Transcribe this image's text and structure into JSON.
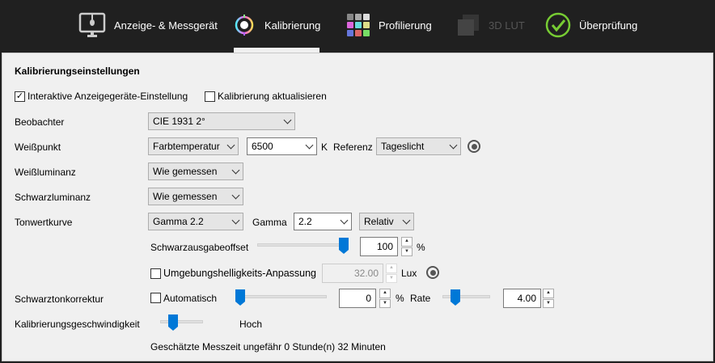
{
  "tabs": [
    {
      "label": "Anzeige- & Messgerät"
    },
    {
      "label": "Kalibrierung"
    },
    {
      "label": "Profilierung"
    },
    {
      "label": "3D LUT"
    },
    {
      "label": "Überprüfung"
    }
  ],
  "section_title": "Kalibrierungseinstellungen",
  "interactive": {
    "label": "Interaktive Anzeigegeräte-Einstellung",
    "checked": true
  },
  "update": {
    "label": "Kalibrierung aktualisieren",
    "checked": false
  },
  "observer": {
    "label": "Beobachter",
    "value": "CIE 1931 2°"
  },
  "whitepoint": {
    "label": "Weißpunkt",
    "mode": "Farbtemperatur",
    "temp": "6500",
    "unit": "K",
    "ref_label": "Referenz",
    "ref": "Tageslicht"
  },
  "white_lum": {
    "label": "Weißluminanz",
    "value": "Wie gemessen"
  },
  "black_lum": {
    "label": "Schwarzluminanz",
    "value": "Wie gemessen"
  },
  "tone": {
    "label": "Tonwertkurve",
    "curve": "Gamma 2.2",
    "gamma_label": "Gamma",
    "gamma": "2.2",
    "mode": "Relativ"
  },
  "black_offset": {
    "label": "Schwarzausgabeoffset",
    "value": "100",
    "unit": "%",
    "slider_percent": 100
  },
  "ambient": {
    "label": "Umgebungshelligkeits-Anpassung",
    "checked": false,
    "value": "32.00",
    "unit": "Lux"
  },
  "black_corr": {
    "label": "Schwarztonkorrektur",
    "auto_label": "Automatisch",
    "checked": false,
    "value": "0",
    "unit": "%",
    "slider_percent": 0,
    "rate_label": "Rate",
    "rate": "4.00",
    "rate_slider_percent": 25
  },
  "speed": {
    "label": "Kalibrierungsgeschwindigkeit",
    "value": "Hoch",
    "slider_percent": 25
  },
  "estimate": "Geschätzte Messzeit ungefähr 0 Stunde(n) 32 Minuten"
}
